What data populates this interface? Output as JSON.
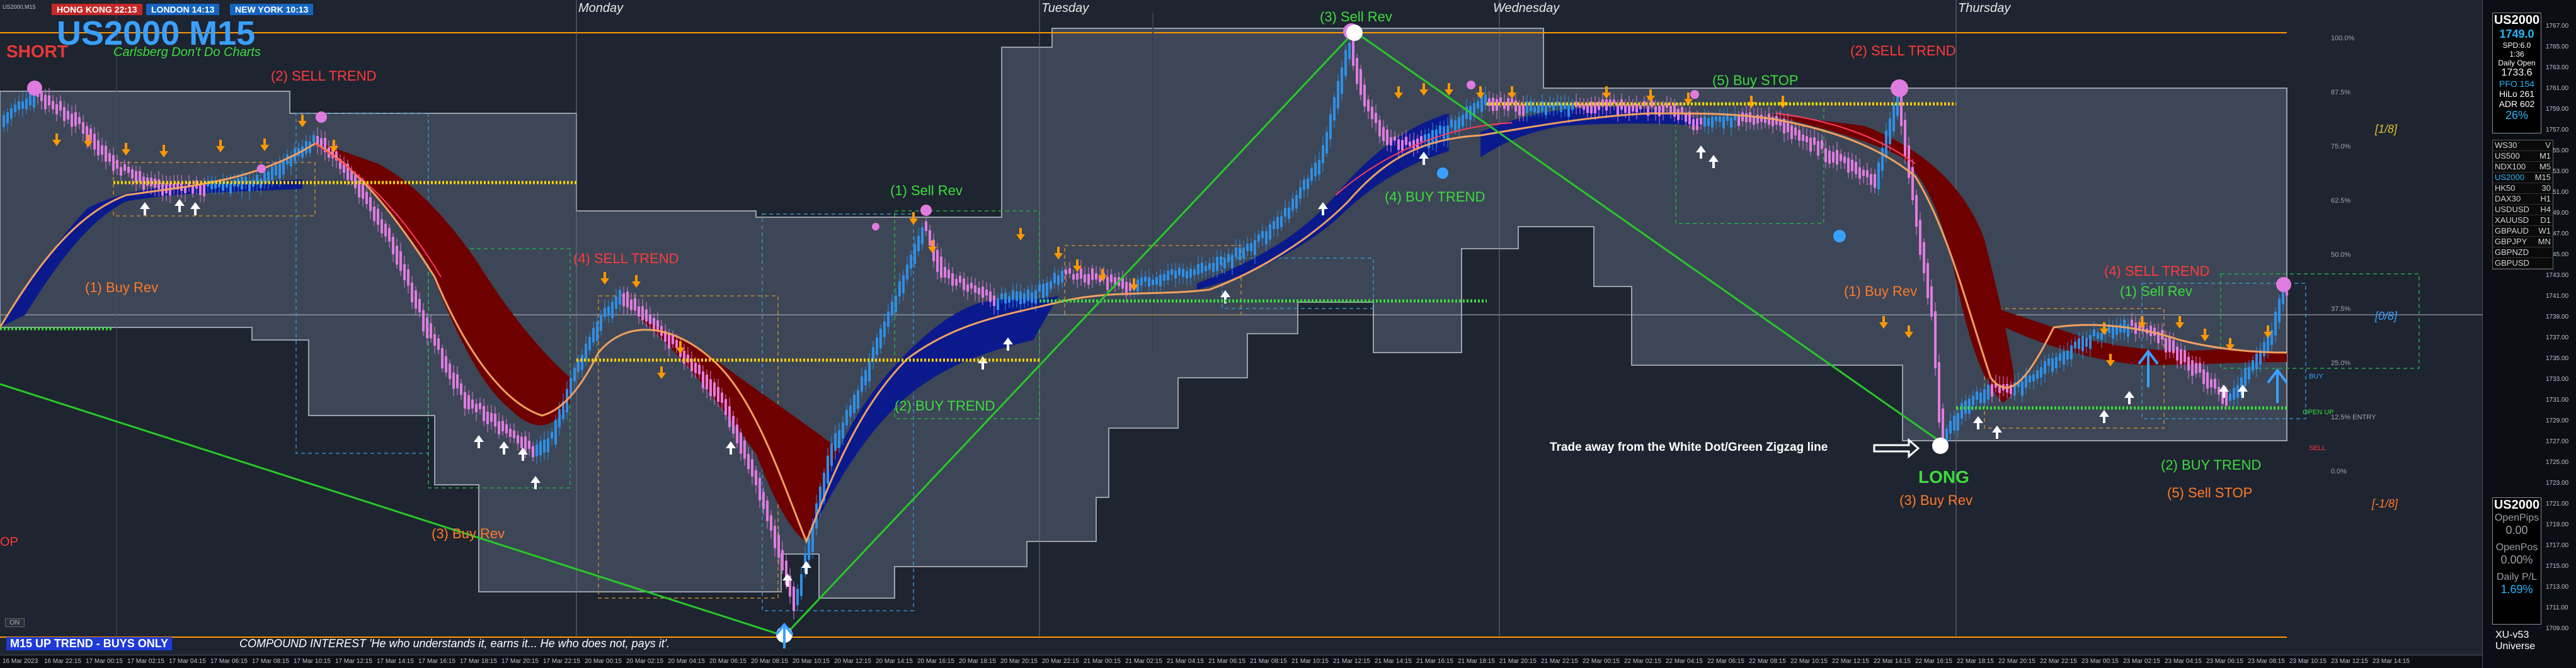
{
  "header": {
    "symbol_tf": "US2000 M15",
    "subtitle": "Carlsberg Don't Do Charts",
    "signal": "SHORT",
    "clocks": [
      {
        "label": "HONG KONG 22:13",
        "color": "#c62828"
      },
      {
        "label": "LONDON 14:13",
        "color": "#1565c0"
      },
      {
        "label": "NEW YORK 10:13",
        "color": "#1565c0"
      }
    ],
    "corner_symbol": "US2000,M15"
  },
  "days": [
    "Monday",
    "Tuesday",
    "Wednesday",
    "Thursday"
  ],
  "annotations": {
    "sell_trend_1": "(2) SELL TREND",
    "buy_rev_1": "(1) Buy Rev",
    "sell_trend_2": "(4) SELL TREND",
    "buy_rev_3": "(3) Buy Rev",
    "sell_rev_1": "(1) Sell Rev",
    "buy_trend_2": "(2) BUY TREND",
    "sell_rev_3": "(3) Sell Rev",
    "buy_trend_4": "(4) BUY TREND",
    "buy_stop_5": "(5) Buy STOP",
    "sell_trend_2b": "(2) SELL TREND",
    "buy_rev_1b": "(1) Buy Rev",
    "trade_away": "Trade away from the White Dot/Green Zigzag line",
    "long": "LONG",
    "buy_rev_3b": "(3) Buy Rev",
    "sell_trend_4b": "(4) SELL TREND",
    "sell_rev_1b": "(1) Sell Rev",
    "buy_trend_2b": "(2) BUY TREND",
    "sell_stop_5": "(5) Sell STOP",
    "op_left": "OP",
    "on_tag": "ON"
  },
  "fib_levels": {
    "upper": "[1/8]",
    "mid": "[0/8]",
    "lower": "[-1/8]",
    "buy": "BUY",
    "open_up": "OPEN UP",
    "sell": "SELL"
  },
  "pct_levels": [
    "100.0%",
    "87.5%",
    "75.0%",
    "62.5%",
    "50.0%",
    "37.5%",
    "25.0%",
    "12.5% ENTRY",
    "0.0%"
  ],
  "footer": {
    "trend": "M15 UP TREND - BUYS ONLY",
    "quote": "COMPOUND INTEREST 'He who understands it, earns it... He who does not, pays it'."
  },
  "info_panel": {
    "symbol": "US2000",
    "price": "1749.0",
    "spread": "SPD:6.0",
    "countdown": "1:36",
    "daily_open_label": "Daily Open",
    "daily_open": "1733.6",
    "pfo": "PFO 154",
    "hilo": "HiLo 261",
    "adr": "ADR 602",
    "adr_pct": "26%"
  },
  "symbols": [
    {
      "name": "WS30",
      "tf": "V"
    },
    {
      "name": "US500",
      "tf": "M1"
    },
    {
      "name": "NDX100",
      "tf": "M5"
    },
    {
      "name": "US2000",
      "tf": "M15"
    },
    {
      "name": "HK50",
      "tf": "30"
    },
    {
      "name": "DAX30",
      "tf": "H1"
    },
    {
      "name": "USDUSD",
      "tf": "H4"
    },
    {
      "name": "XAUUSD",
      "tf": "D1"
    },
    {
      "name": "GBPAUD",
      "tf": "W1"
    },
    {
      "name": "GBPJPY",
      "tf": "MN"
    },
    {
      "name": "GBPNZD",
      "tf": ""
    },
    {
      "name": "GBPUSD",
      "tf": ""
    }
  ],
  "pnl_panel": {
    "symbol": "US2000",
    "open_pips_label": "OpenPips",
    "open_pips": "0.00",
    "open_pos_label": "OpenPos",
    "open_pos": "0.00%",
    "daily_pl_label": "Daily P/L",
    "daily_pl": "1.69%"
  },
  "version": {
    "name": "XU-v53",
    "label": "Universe"
  },
  "price_ticks": [
    "1767.00",
    "1765.00",
    "1763.00",
    "1761.00",
    "1759.00",
    "1757.00",
    "1755.00",
    "1753.00",
    "1751.00",
    "1749.00",
    "1747.00",
    "1745.00",
    "1743.00",
    "1741.00",
    "1739.00",
    "1737.00",
    "1735.00",
    "1733.00",
    "1731.00",
    "1729.00",
    "1727.00",
    "1725.00",
    "1723.00",
    "1721.00",
    "1719.00",
    "1717.00",
    "1715.00",
    "1713.00",
    "1711.00",
    "1709.00"
  ],
  "time_ticks": [
    "16 Mar 2023",
    "16 Mar 22:15",
    "17 Mar 00:15",
    "17 Mar 02:15",
    "17 Mar 04:15",
    "17 Mar 06:15",
    "17 Mar 08:15",
    "17 Mar 10:15",
    "17 Mar 12:15",
    "17 Mar 14:15",
    "17 Mar 16:15",
    "17 Mar 18:15",
    "17 Mar 20:15",
    "17 Mar 22:15",
    "20 Mar 00:15",
    "20 Mar 02:15",
    "20 Mar 04:15",
    "20 Mar 06:15",
    "20 Mar 08:15",
    "20 Mar 10:15",
    "20 Mar 12:15",
    "20 Mar 14:15",
    "20 Mar 16:15",
    "20 Mar 18:15",
    "20 Mar 20:15",
    "20 Mar 22:15",
    "21 Mar 00:15",
    "21 Mar 02:15",
    "21 Mar 04:15",
    "21 Mar 06:15",
    "21 Mar 08:15",
    "21 Mar 10:15",
    "21 Mar 12:15",
    "21 Mar 14:15",
    "21 Mar 16:15",
    "21 Mar 18:15",
    "21 Mar 20:15",
    "21 Mar 22:15",
    "22 Mar 00:15",
    "22 Mar 02:15",
    "22 Mar 04:15",
    "22 Mar 06:15",
    "22 Mar 08:15",
    "22 Mar 10:15",
    "22 Mar 12:15",
    "22 Mar 14:15",
    "22 Mar 16:15",
    "22 Mar 18:15",
    "22 Mar 20:15",
    "22 Mar 22:15",
    "23 Mar 00:15",
    "23 Mar 02:15",
    "23 Mar 04:15",
    "23 Mar 06:15",
    "23 Mar 08:15",
    "23 Mar 10:15",
    "23 Mar 12:15",
    "23 Mar 14:15"
  ],
  "colors": {
    "bull": "#2e8fe6",
    "bear": "#e07be0",
    "cloud_up": "#0a1a8c",
    "cloud_down": "#7a0000",
    "zigzag": "#28c828",
    "orange_line": "#ff9800",
    "yellow_dots": "#ffd400"
  }
}
